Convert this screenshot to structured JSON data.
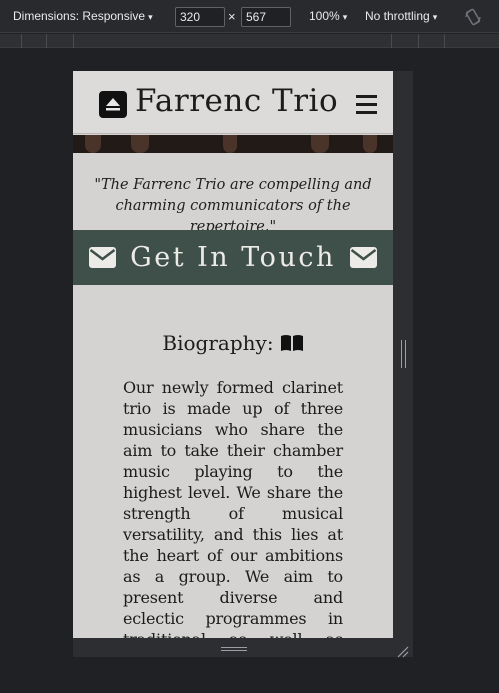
{
  "devtools": {
    "dimensions_label": "Dimensions: Responsive",
    "width_value": "320",
    "height_value": "567",
    "times_symbol": "×",
    "zoom_label": "100%",
    "throttle_label": "No throttling",
    "caret": "▾",
    "rotate_icon": "rotate-icon"
  },
  "site": {
    "brand": "Farrenc Trio",
    "logo_icon": "eject-triangle-icon",
    "menu_icon": "hamburger-icon",
    "quote": "\"The Farrenc Trio are compelling and charming communicators of the repertoire.\"",
    "contact_label": "Get In Touch",
    "contact_icon": "envelope-icon",
    "bio_title": "Biography:",
    "bio_icon": "open-book-icon",
    "bio_text": "Our newly formed clarinet trio is made up of three musicians who share the aim to take their chamber music playing to the highest level. We share the strength of musical versatility, and this lies at the heart of our ambitions as a group. We aim to present diverse and eclectic programmes in traditional as well as unexpected venues, making efforts to programme"
  },
  "colors": {
    "devtools_bg": "#202124",
    "toolbar_bg": "#292a2d",
    "page_bg": "#d4d3d1",
    "contact_bg": "#3f4f4a",
    "text": "#1c1c1c"
  }
}
